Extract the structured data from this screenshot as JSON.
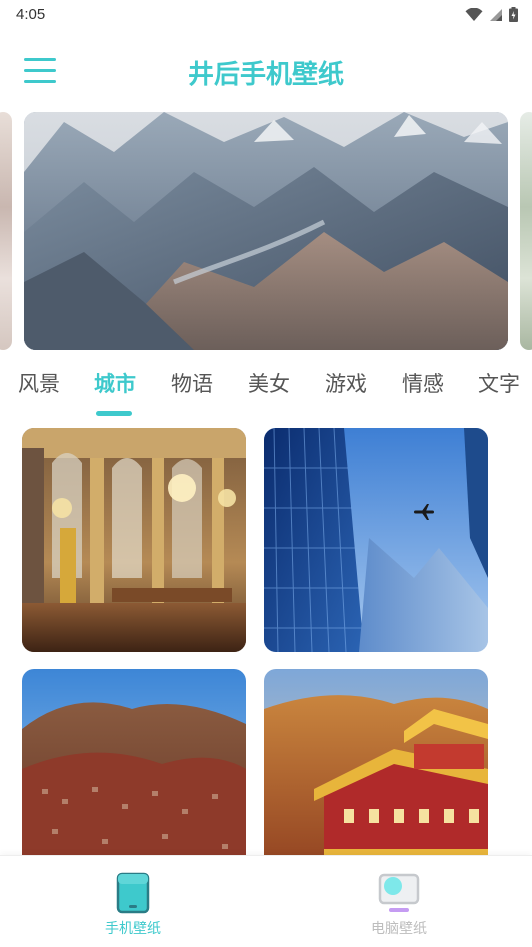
{
  "status_bar": {
    "time": "4:05",
    "icons": [
      "wifi-icon",
      "signal-icon",
      "battery-icon"
    ]
  },
  "header": {
    "title": "井后手机壁纸",
    "menu_icon": "hamburger-menu-icon"
  },
  "banner": {
    "images": [
      "mountain-valley-photo"
    ]
  },
  "tabs": {
    "items": [
      {
        "label": "风景"
      },
      {
        "label": "城市"
      },
      {
        "label": "物语"
      },
      {
        "label": "美女"
      },
      {
        "label": "游戏"
      },
      {
        "label": "情感"
      },
      {
        "label": "文字"
      }
    ],
    "selected": "城市"
  },
  "wallpapers": [
    {
      "subject": "palace-hall-of-mirrors"
    },
    {
      "subject": "skyscraper-with-airplane"
    },
    {
      "subject": "hillside-red-houses"
    },
    {
      "subject": "golden-temple-buildings"
    }
  ],
  "bottom_nav": {
    "items": [
      {
        "label": "手机壁纸",
        "icon": "phone-icon",
        "active": true
      },
      {
        "label": "电脑壁纸",
        "icon": "monitor-icon",
        "active": false
      }
    ]
  },
  "colors": {
    "accent": "#3ec9cc",
    "inactive": "#bdbdbd",
    "accent_secondary": "#c59cf2"
  }
}
